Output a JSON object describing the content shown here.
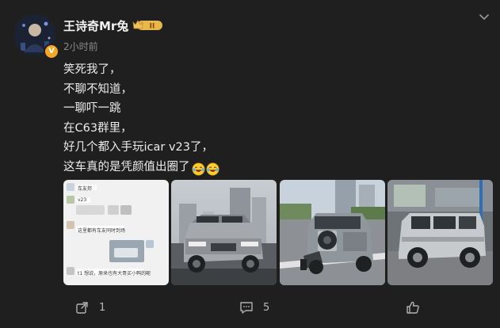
{
  "post": {
    "author": "王诗奇Mr兔",
    "level_badge": "II",
    "verified_mark": "V",
    "timestamp": "2小时前",
    "lines": [
      "笑死我了，",
      "不聊不知道，",
      "一聊吓一跳",
      "在C63群里，",
      "好几个都入手玩icar v23了，",
      "这车真的是凭颜值出圈了"
    ],
    "emojis": [
      "laughing-tears-emoji",
      "laughing-tears-emoji"
    ]
  },
  "images": {
    "chat": {
      "lines": [
        "车友邦",
        "v23",
        "这里都有车友同时到场",
        "t1 想说，原来也有大哥买小鸭的呢"
      ]
    }
  },
  "actions": {
    "share_count": "1",
    "comment_count": "5",
    "like_count": ""
  },
  "colors": {
    "background": "#1f1f1f",
    "text": "#ececec",
    "muted": "#8a8a8a",
    "verified": "#f5a623",
    "level_badge": "#e8b64a"
  },
  "icons": {
    "more": "chevron-down-icon",
    "share": "share-icon",
    "comment": "comment-icon",
    "like": "thumbs-up-icon"
  }
}
